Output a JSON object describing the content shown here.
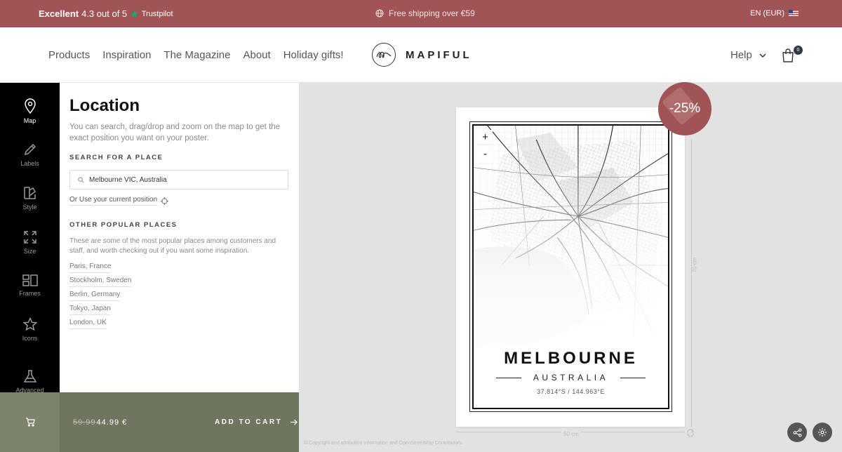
{
  "topbar": {
    "trustpilot_excellent": "Excellent",
    "trustpilot_rating": "4.3 out of 5",
    "trustpilot_brand": "Trustpilot",
    "shipping": "Free shipping over €59",
    "language": "EN (EUR)"
  },
  "nav": {
    "items": [
      "Products",
      "Inspiration",
      "The Magazine",
      "About",
      "Holiday gifts!"
    ],
    "help": "Help",
    "cart_count": "0"
  },
  "brand": {
    "name": "MAPIFUL"
  },
  "rail": {
    "items": [
      {
        "label": "Map",
        "icon": "map-pin-icon"
      },
      {
        "label": "Labels",
        "icon": "pencil-icon"
      },
      {
        "label": "Style",
        "icon": "palette-icon"
      },
      {
        "label": "Size",
        "icon": "resize-icon"
      },
      {
        "label": "Frames",
        "icon": "frames-icon"
      },
      {
        "label": "Icons",
        "icon": "star-icon"
      },
      {
        "label": "Advanced",
        "icon": "flask-icon"
      }
    ]
  },
  "panel": {
    "title": "Location",
    "intro": "You can search, drag/drop and zoom on the map to get the exact position you want on your poster.",
    "search_heading": "SEARCH FOR A PLACE",
    "search_value": "Melbourne VIC, Australia",
    "current_position": "Or Use your current position",
    "popular_heading": "OTHER POPULAR PLACES",
    "popular_desc": "These are some of the most popular places among customers and staff, and worth checking out if you want some inspiration.",
    "places": [
      "Paris, France",
      "Stockholm, Sweden",
      "Berlin, Germany",
      "Tokyo, Japan",
      "London, UK"
    ]
  },
  "cart": {
    "old_price": "59.99",
    "price": "44.99 €",
    "add_label": "ADD TO CART"
  },
  "poster": {
    "city": "MELBOURNE",
    "country": "AUSTRALIA",
    "coordinates": "37.814°S / 144.963°E",
    "zoom_in": "+",
    "zoom_out": "-",
    "discount": "-25%",
    "height_label": "70 cm",
    "width_label": "50 cm",
    "copyright": "© Copyright and attribution information and OpenStreetMap Contributors"
  },
  "colors": {
    "accent": "#a15455",
    "cart_bar": "#6f7660",
    "rail": "#000000"
  }
}
